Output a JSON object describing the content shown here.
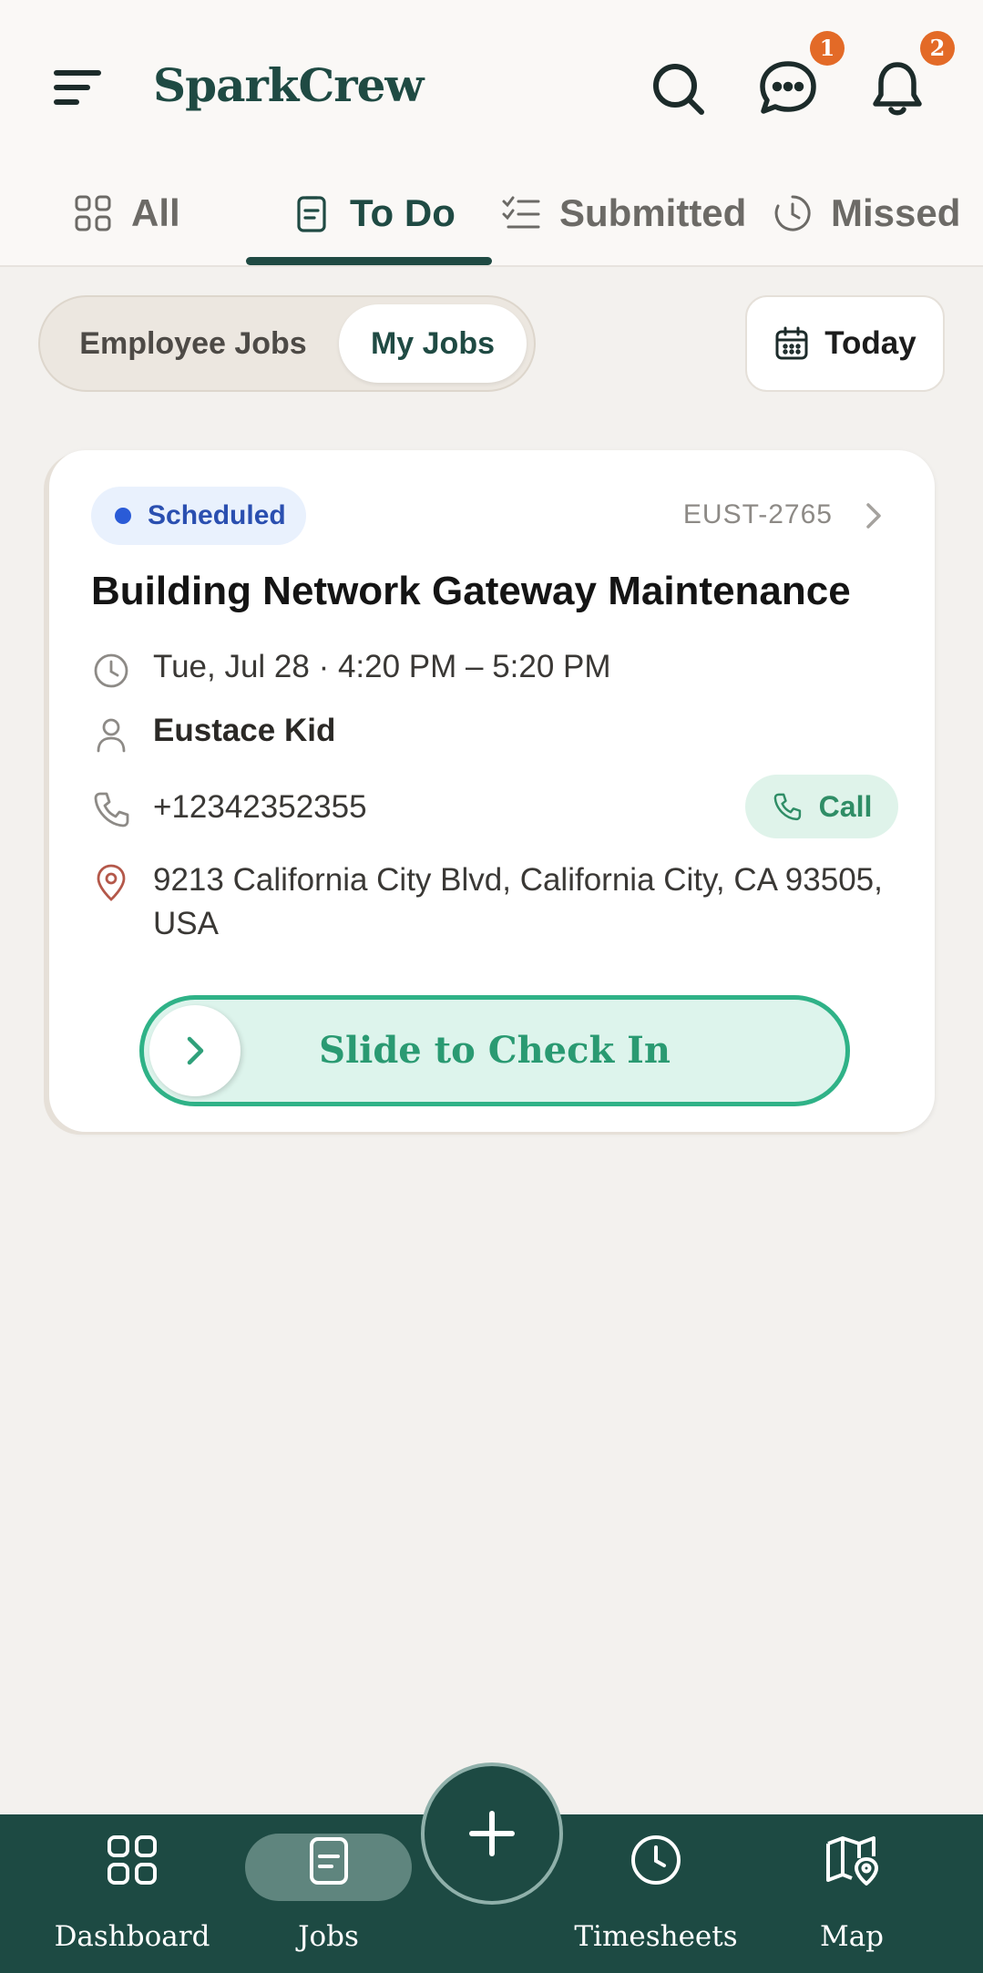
{
  "header": {
    "brand": "SparkCrew",
    "messages_badge": "1",
    "notifications_badge": "2"
  },
  "tabs": [
    {
      "label": "All",
      "icon": "grid-icon"
    },
    {
      "label": "To Do",
      "icon": "clipboard-icon",
      "active": true
    },
    {
      "label": "Submitted",
      "icon": "checklist-icon"
    },
    {
      "label": "Missed",
      "icon": "clock-icon"
    }
  ],
  "segment": {
    "employee_jobs": "Employee Jobs",
    "my_jobs": "My Jobs",
    "selected": "My Jobs"
  },
  "date_filter": {
    "label": "Today"
  },
  "job": {
    "status": "Scheduled",
    "id": "EUST-2765",
    "title": "Building Network Gateway Maintenance",
    "datetime": "Tue, Jul 28 · 4:20 PM – 5:20 PM",
    "customer": "Eustace Kid",
    "phone": "+12342352355",
    "call_label": "Call",
    "address_line1": "9213 California City Blvd, California City, CA 93505,",
    "address_line2": "USA",
    "slide_label": "Slide to Check In"
  },
  "bottom_nav": [
    {
      "label": "Dashboard",
      "icon": "grid-icon"
    },
    {
      "label": "Jobs",
      "icon": "clipboard-icon",
      "active": true
    },
    {
      "label": "Timesheets",
      "icon": "clock-icon"
    },
    {
      "label": "Map",
      "icon": "map-pin-icon"
    }
  ],
  "colors": {
    "brand": "#1f4a43",
    "badge": "#e36a27",
    "accent_green": "#2fb287",
    "status_blue": "#2a5bd7",
    "background": "#f3f1ee"
  }
}
